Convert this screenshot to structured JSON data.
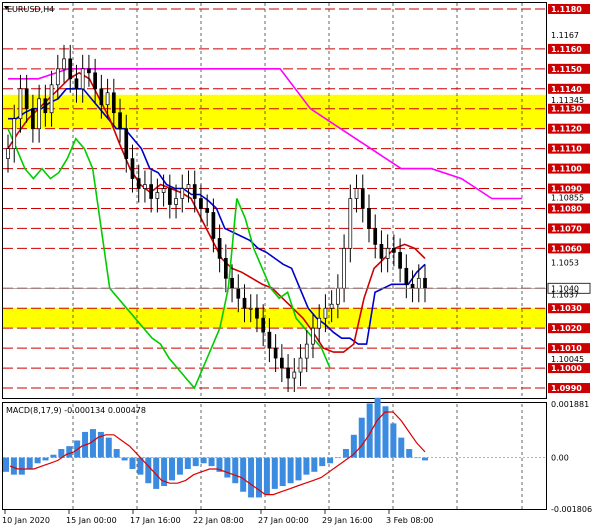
{
  "chart_data": [
    {
      "type": "candlestick",
      "title": "EURUSD,H4",
      "ylim": [
        1.0985,
        1.1183
      ],
      "x_ticks": [
        "10 Jan 2020",
        "15 Jan 00:00",
        "17 Jan 16:00",
        "22 Jan 08:00",
        "27 Jan 00:00",
        "29 Jan 16:00",
        "3 Feb 08:00"
      ],
      "levels": [
        1.118,
        1.116,
        1.115,
        1.114,
        1.113,
        1.112,
        1.111,
        1.11,
        1.109,
        1.108,
        1.107,
        1.106,
        1.104,
        1.103,
        1.102,
        1.101,
        1.1,
        1.099
      ],
      "level_color": "#cc0000",
      "zones": [
        {
          "from": 1.112,
          "to": 1.1137,
          "color": "#ffff00"
        },
        {
          "from": 1.102,
          "to": 1.103,
          "color": "#ffff00"
        }
      ],
      "price_scale_ticks": [
        1.1167,
        1.11345,
        1.10855,
        1.1053,
        1.1037,
        1.10045
      ],
      "current_price": 1.104,
      "closes": [
        1.111,
        1.1125,
        1.114,
        1.113,
        1.112,
        1.1135,
        1.1128,
        1.1142,
        1.115,
        1.1155,
        1.1145,
        1.114,
        1.115,
        1.1148,
        1.114,
        1.1132,
        1.1138,
        1.1128,
        1.112,
        1.1105,
        1.1095,
        1.109,
        1.1092,
        1.1085,
        1.1088,
        1.109,
        1.1082,
        1.1085,
        1.109,
        1.1092,
        1.1085,
        1.108,
        1.1078,
        1.1065,
        1.1055,
        1.1045,
        1.104,
        1.1035,
        1.103,
        1.103,
        1.1025,
        1.1018,
        1.101,
        1.1005,
        1.1,
        1.0995,
        1.0998,
        1.1005,
        1.1012,
        1.102,
        1.1025,
        1.103,
        1.1032,
        1.104,
        1.106,
        1.1085,
        1.109,
        1.108,
        1.107,
        1.1062,
        1.1055,
        1.106,
        1.1058,
        1.105,
        1.1042,
        1.104,
        1.1045,
        1.104
      ],
      "series": [
        {
          "name": "",
          "color": "#0000cc",
          "values": [
            1.1125,
            1.1125,
            1.1128,
            1.113,
            1.113,
            1.1133,
            1.1135,
            1.114,
            1.114,
            1.114,
            1.1135,
            1.113,
            1.1125,
            1.112,
            1.112,
            1.1115,
            1.111,
            1.11,
            1.1098,
            1.1092,
            1.109,
            1.109,
            1.1087,
            1.1087,
            1.1084,
            1.108,
            1.107,
            1.1068,
            1.1066,
            1.1064,
            1.106,
            1.1058,
            1.1055,
            1.1052,
            1.105,
            1.104,
            1.103,
            1.1025,
            1.1022,
            1.1018,
            1.1015,
            1.1015,
            1.1012,
            1.1012,
            1.1038,
            1.104,
            1.1042,
            1.1042,
            1.1042,
            1.1048,
            1.1052
          ]
        },
        {
          "name": "",
          "color": "#cc0000",
          "values": [
            1.111,
            1.1118,
            1.1125,
            1.113,
            1.1135,
            1.114,
            1.1145,
            1.1148,
            1.1145,
            1.1135,
            1.1125,
            1.1112,
            1.11,
            1.1092,
            1.1088,
            1.1092,
            1.109,
            1.1088,
            1.1085,
            1.1075,
            1.1065,
            1.1055,
            1.105,
            1.1048,
            1.1045,
            1.1042,
            1.104,
            1.1035,
            1.103,
            1.1025,
            1.1018,
            1.101,
            1.1008,
            1.1008,
            1.1012,
            1.1035,
            1.105,
            1.1055,
            1.106,
            1.1062,
            1.106,
            1.1055
          ]
        },
        {
          "name": "",
          "color": "#00cc00",
          "values": [
            1.112,
            1.111,
            1.11,
            1.1095,
            1.11,
            1.1095,
            1.1098,
            1.1105,
            1.1115,
            1.111,
            1.11,
            1.107,
            1.104,
            1.1035,
            1.103,
            1.1025,
            1.102,
            1.1015,
            1.1012,
            1.1005,
            1.1,
            1.0995,
            1.099,
            1.1,
            1.101,
            1.102,
            1.104,
            1.1085,
            1.1075,
            1.106,
            1.105,
            1.104,
            1.1035,
            1.1038,
            1.1025,
            1.102,
            1.1015,
            1.101,
            1.1
          ]
        },
        {
          "name": "",
          "color": "#ff00ff",
          "values": [
            1.1145,
            1.1145,
            1.115,
            1.115,
            1.115,
            1.115,
            1.115,
            1.115,
            1.115,
            1.115,
            1.113,
            1.112,
            1.111,
            1.11,
            1.11,
            1.1095,
            1.1085,
            1.1085
          ]
        }
      ]
    },
    {
      "type": "bar",
      "title": "MACD(8,17,9) -0.000134 0.000478",
      "ylim": [
        -0.001806,
        0.001881
      ],
      "y_ticks": [
        0.001881,
        0.0,
        -0.001806
      ],
      "bar_color": "#3b8be0",
      "signal_color": "#dd0000",
      "values": [
        -0.0005,
        -0.0006,
        -0.0006,
        -0.0004,
        -0.0002,
        -0.0001,
        0.0001,
        0.0003,
        0.0004,
        0.0006,
        0.0009,
        0.001,
        0.0009,
        0.0007,
        0.0003,
        -0.0001,
        -0.0004,
        -0.0006,
        -0.0009,
        -0.0011,
        -0.001,
        -0.0008,
        -0.0006,
        -0.0004,
        -0.0003,
        -0.0002,
        -0.0003,
        -0.0005,
        -0.0007,
        -0.0009,
        -0.0012,
        -0.0014,
        -0.0014,
        -0.0013,
        -0.0011,
        -0.001,
        -0.0009,
        -0.0008,
        -0.0006,
        -0.0005,
        -0.0003,
        -0.0002,
        0.0,
        0.0003,
        0.0008,
        0.0014,
        0.0019,
        0.0021,
        0.0018,
        0.0012,
        0.0007,
        0.0003,
        0.0,
        -0.0001
      ],
      "signal": [
        -0.0003,
        -0.0004,
        -0.0004,
        -0.0004,
        -0.0003,
        -0.0002,
        -0.0001,
        0.0001,
        0.0002,
        0.0004,
        0.0005,
        0.0007,
        0.0008,
        0.0008,
        0.0006,
        0.0004,
        0.0001,
        -0.0002,
        -0.0005,
        -0.0008,
        -0.0009,
        -0.0009,
        -0.0008,
        -0.0006,
        -0.0005,
        -0.0004,
        -0.0004,
        -0.0005,
        -0.0006,
        -0.0007,
        -0.0009,
        -0.0011,
        -0.0013,
        -0.0013,
        -0.0012,
        -0.0011,
        -0.001,
        -0.0009,
        -0.0008,
        -0.0007,
        -0.0005,
        -0.0003,
        -0.0001,
        0.0001,
        0.0004,
        0.0008,
        0.0013,
        0.0016,
        0.0016,
        0.0013,
        0.0009,
        0.0005,
        0.0002
      ]
    }
  ]
}
